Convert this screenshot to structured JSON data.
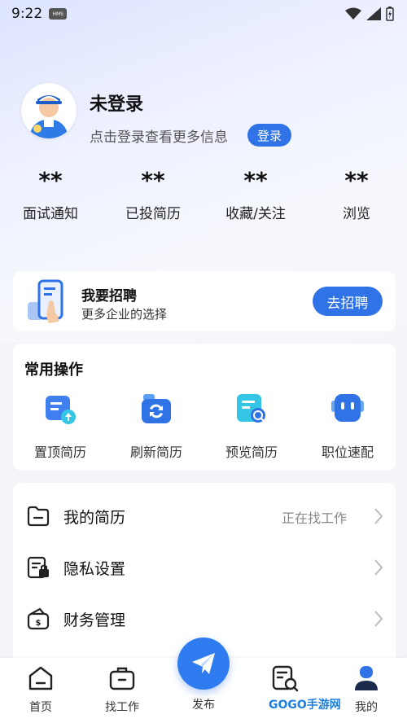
{
  "status_bar": {
    "time": "9:22",
    "badge": "HMS"
  },
  "profile": {
    "name": "未登录",
    "hint": "点击登录查看更多信息",
    "login_label": "登录"
  },
  "stats": [
    {
      "value": "**",
      "label": "面试通知"
    },
    {
      "value": "**",
      "label": "已投简历"
    },
    {
      "value": "**",
      "label": "收藏/关注"
    },
    {
      "value": "**",
      "label": "浏览"
    }
  ],
  "recruit": {
    "title": "我要招聘",
    "subtitle": "更多企业的选择",
    "button": "去招聘"
  },
  "ops": {
    "title": "常用操作",
    "items": [
      {
        "label": "置顶简历",
        "icon": "resume-top-icon"
      },
      {
        "label": "刷新简历",
        "icon": "refresh-resume-icon"
      },
      {
        "label": "预览简历",
        "icon": "preview-resume-icon"
      },
      {
        "label": "职位速配",
        "icon": "job-match-icon"
      }
    ]
  },
  "menu": [
    {
      "label": "我的简历",
      "status": "正在找工作",
      "icon": "folder-icon"
    },
    {
      "label": "隐私设置",
      "status": "",
      "icon": "privacy-lock-icon"
    },
    {
      "label": "财务管理",
      "status": "",
      "icon": "wallet-icon"
    }
  ],
  "tabbar": {
    "items": [
      {
        "label": "首页",
        "icon": "home-icon"
      },
      {
        "label": "找工作",
        "icon": "briefcase-icon"
      },
      {
        "label": "发布",
        "icon": "paper-plane-icon"
      },
      {
        "label": "",
        "icon": "search-document-icon"
      },
      {
        "label": "我的",
        "icon": "profile-icon"
      }
    ],
    "active": "我的"
  },
  "watermark": "GOGO手游网",
  "colors": {
    "accent": "#2f73e6",
    "background": "#f3f5f9"
  }
}
